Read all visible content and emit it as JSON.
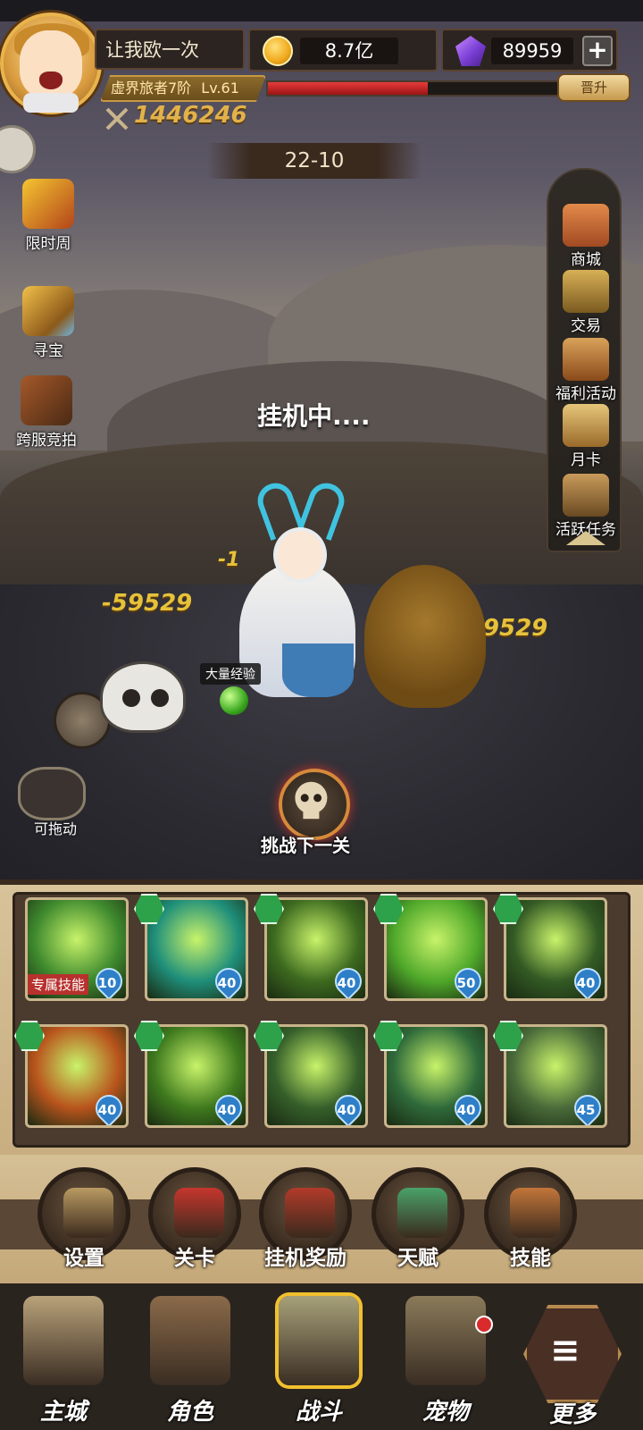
{
  "player": {
    "name": "让我欧一次",
    "rank": "虚界旅者7阶",
    "level": "Lv.61",
    "power": "1446246",
    "exp_progress": 0.55,
    "promote_label": "晋升"
  },
  "resources": {
    "gold": "8.7亿",
    "gems": "89959",
    "add_label": "+"
  },
  "stage": "22-10",
  "left_side": [
    {
      "label": "限时周",
      "icon": "gift-box-icon"
    },
    {
      "label": "寻宝",
      "icon": "treasure-chest-icon"
    },
    {
      "label": "跨服竞拍",
      "icon": "auction-hammer-icon"
    }
  ],
  "right_side": [
    {
      "label": "商城",
      "icon": "shop-icon"
    },
    {
      "label": "交易",
      "icon": "scales-icon"
    },
    {
      "label": "福利活动",
      "icon": "gift-icon"
    },
    {
      "label": "月卡",
      "icon": "month-card-icon"
    },
    {
      "label": "活跃任务",
      "icon": "task-scroll-icon"
    }
  ],
  "battle": {
    "status": "挂机中....",
    "damage_left": "-59529",
    "damage_right": "-59529",
    "damage_small": "-1",
    "exp_tag": "大量经验",
    "drag_label": "可拖动",
    "challenge_label": "挑战下一关"
  },
  "skills": [
    {
      "level": "10",
      "exclusive": "专属技能",
      "color": "#3f8a2e"
    },
    {
      "level": "40",
      "color": "#1f8f7a"
    },
    {
      "level": "40",
      "color": "#3d6a1f"
    },
    {
      "level": "50",
      "color": "#4fa82a"
    },
    {
      "level": "40",
      "color": "#335a24"
    },
    {
      "level": "40",
      "color": "#b8541c"
    },
    {
      "level": "40",
      "color": "#3f7a1e"
    },
    {
      "level": "40",
      "color": "#355f2a"
    },
    {
      "level": "40",
      "color": "#2f6a3a"
    },
    {
      "level": "45",
      "color": "#4a6b3a"
    }
  ],
  "functions": [
    {
      "label": "设置",
      "icon": "gears-icon"
    },
    {
      "label": "关卡",
      "icon": "banner-icon"
    },
    {
      "label": "挂机奖励",
      "icon": "chest-icon"
    },
    {
      "label": "天赋",
      "icon": "talent-tree-icon"
    },
    {
      "label": "技能",
      "icon": "star-badge-icon"
    }
  ],
  "nav": [
    {
      "label": "主城",
      "icon": "castle-icon"
    },
    {
      "label": "角色",
      "icon": "helmet-icon"
    },
    {
      "label": "战斗",
      "icon": "cannon-icon",
      "active": true
    },
    {
      "label": "宠物",
      "icon": "pet-icon",
      "notify": true
    },
    {
      "label": "更多",
      "icon": "more-menu-icon"
    }
  ],
  "colors": {
    "gold_text": "#e2b24a",
    "exp_bar": "#e73b3b",
    "skill_badge": "#2e7fc8",
    "active_nav": "#f2c02e"
  }
}
